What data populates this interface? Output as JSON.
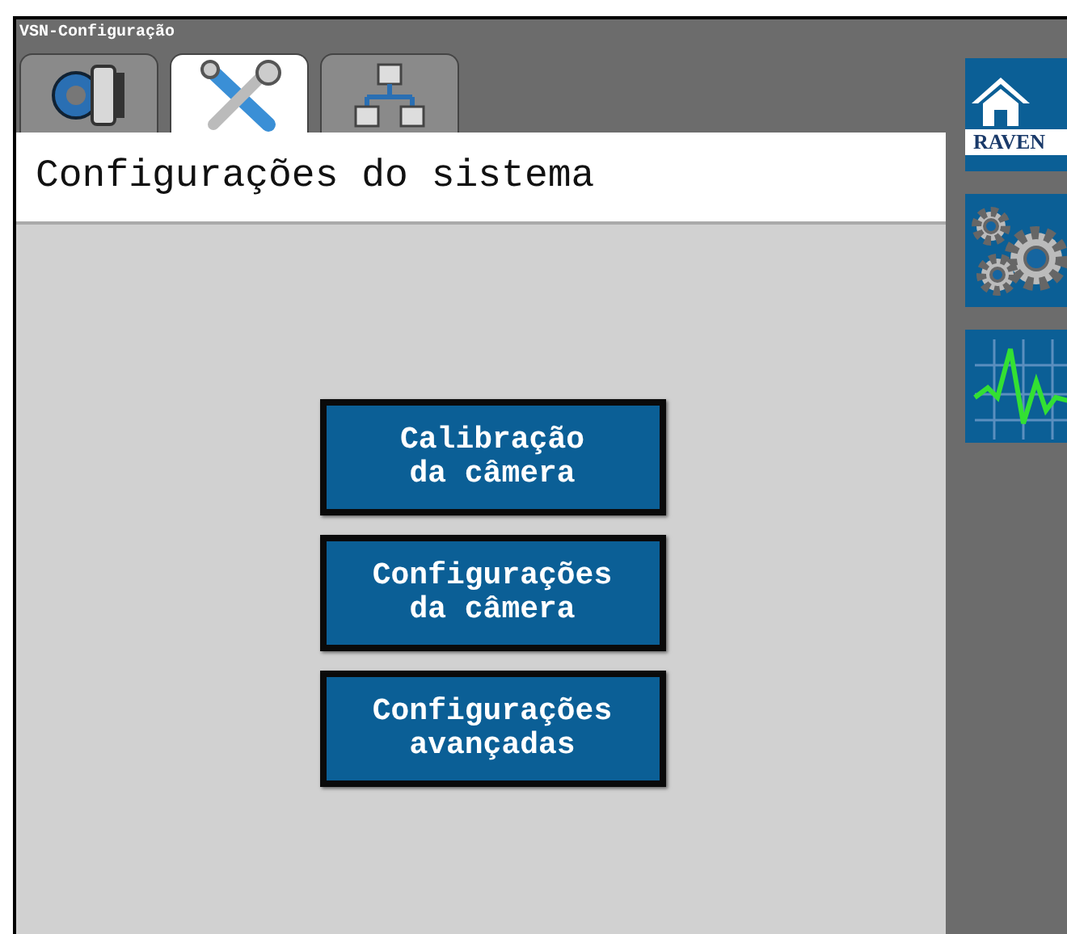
{
  "window": {
    "title": "VSN-Configuração"
  },
  "tabs": [
    {
      "kind": "machine",
      "selected": false
    },
    {
      "kind": "tools",
      "selected": true
    },
    {
      "kind": "network",
      "selected": false
    }
  ],
  "header": {
    "title": "Configurações do sistema"
  },
  "buttons": [
    {
      "lines": [
        "Calibração",
        "da câmera"
      ]
    },
    {
      "lines": [
        "Configurações",
        "da câmera"
      ]
    },
    {
      "lines": [
        "Configurações",
        "avançadas"
      ]
    }
  ],
  "sidebar": [
    {
      "kind": "home",
      "label": "RAVEN"
    },
    {
      "kind": "settings"
    },
    {
      "kind": "graph"
    }
  ]
}
